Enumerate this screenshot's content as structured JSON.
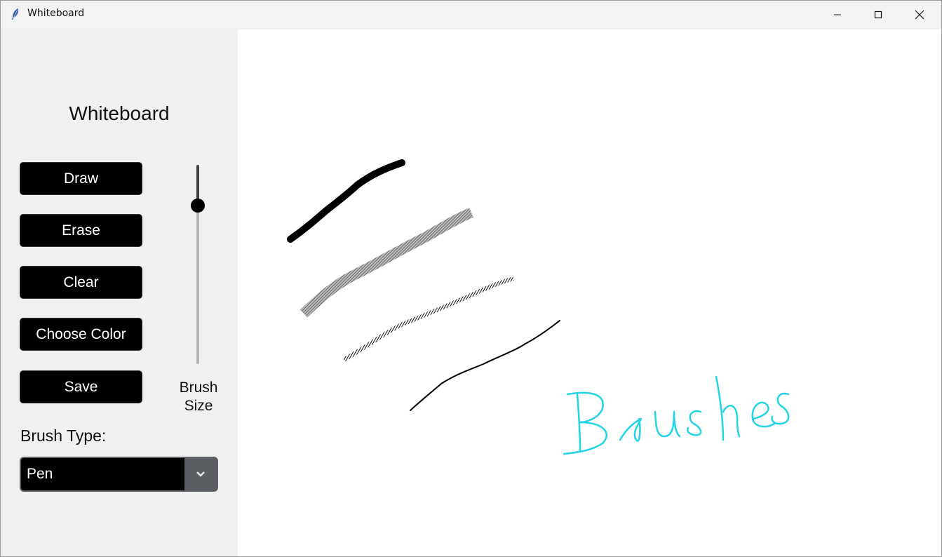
{
  "window": {
    "title": "Whiteboard",
    "controls": {
      "minimize_icon": "minimize-icon",
      "maximize_icon": "maximize-icon",
      "close_icon": "close-icon"
    }
  },
  "sidebar": {
    "title": "Whiteboard",
    "buttons": {
      "draw": "Draw",
      "erase": "Erase",
      "clear": "Clear",
      "choose_color": "Choose Color",
      "save": "Save"
    },
    "brush_size": {
      "label_line1": "Brush",
      "label_line2": "Size"
    },
    "brush_type": {
      "label": "Brush Type:",
      "selected": "Pen"
    }
  },
  "canvas": {
    "text_stroke_color": "#22d4e6",
    "stroke_colors": [
      "#000000",
      "#707070",
      "#000000",
      "#000000"
    ]
  },
  "colors": {
    "button_bg": "#000000",
    "button_text": "#ffffff",
    "panel_bg": "#f0f0f0",
    "canvas_bg": "#ffffff"
  }
}
